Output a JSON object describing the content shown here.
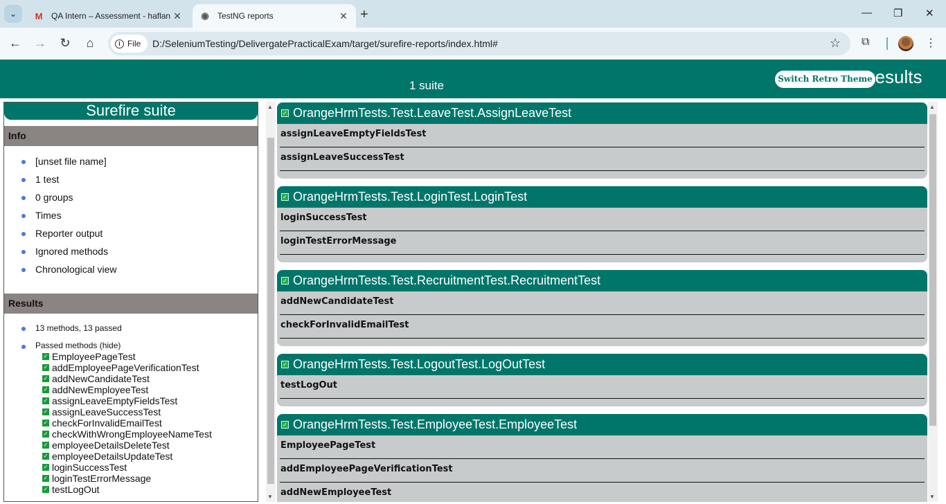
{
  "browser": {
    "tabs": [
      {
        "title": "QA Intern – Assessment - haflan",
        "favicon": "gmail-icon",
        "active": false
      },
      {
        "title": "TestNG reports",
        "favicon": "globe-icon",
        "active": true
      }
    ],
    "file_chip": "File",
    "url": "D:/SeleniumTesting/DelivergatePracticalExam/target/surefire-reports/index.html#"
  },
  "header": {
    "suites": "1 suite",
    "title": "Test results",
    "retro_button": "Switch Retro Theme"
  },
  "left": {
    "suite_title": "Surefire suite",
    "info_header": "Info",
    "info_items": [
      "[unset file name]",
      "1 test",
      "0 groups",
      "Times",
      "Reporter output",
      "Ignored methods",
      "Chronological view"
    ],
    "results_header": "Results",
    "summary": "13 methods, 13 passed",
    "passed_label": "Passed methods (hide)",
    "passed_methods": [
      "EmployeePageTest",
      "addEmployeePageVerificationTest",
      "addNewCandidateTest",
      "addNewEmployeeTest",
      "assignLeaveEmptyFieldsTest",
      "assignLeaveSuccessTest",
      "checkForInvalidEmailTest",
      "checkWithWrongEmployeeNameTest",
      "employeeDetailsDeleteTest",
      "employeeDetailsUpdateTest",
      "loginSuccessTest",
      "loginTestErrorMessage",
      "testLogOut"
    ]
  },
  "classes": [
    {
      "name": "OrangeHrmTests.Test.LeaveTest.AssignLeaveTest",
      "methods": [
        "assignLeaveEmptyFieldsTest",
        "assignLeaveSuccessTest"
      ]
    },
    {
      "name": "OrangeHrmTests.Test.LoginTest.LoginTest",
      "methods": [
        "loginSuccessTest",
        "loginTestErrorMessage"
      ]
    },
    {
      "name": "OrangeHrmTests.Test.RecruitmentTest.RecruitmentTest",
      "methods": [
        "addNewCandidateTest",
        "checkForInvalidEmailTest"
      ]
    },
    {
      "name": "OrangeHrmTests.Test.LogoutTest.LogOutTest",
      "methods": [
        "testLogOut"
      ]
    },
    {
      "name": "OrangeHrmTests.Test.EmployeeTest.EmployeeTest",
      "methods": [
        "EmployeePageTest",
        "addEmployeePageVerificationTest",
        "addNewEmployeeTest"
      ]
    }
  ],
  "colors": {
    "accent": "#00766a",
    "section_header": "#8a8482",
    "card_bg": "#c8cbcc"
  }
}
